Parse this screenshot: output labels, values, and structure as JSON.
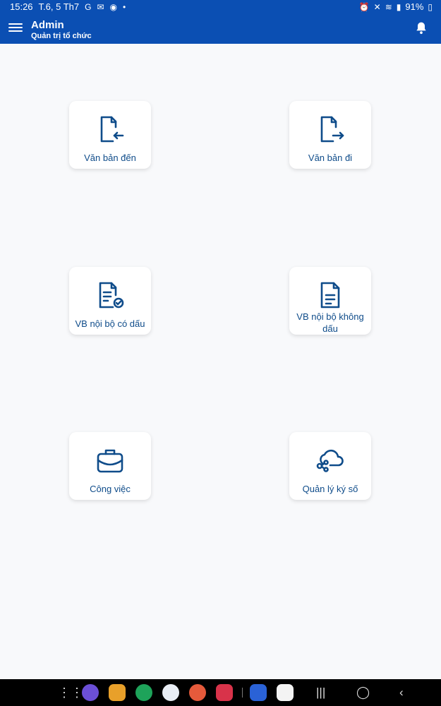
{
  "status_bar": {
    "time": "15:26",
    "date": "T.6, 5 Th7",
    "battery": "91%"
  },
  "app_bar": {
    "title": "Admin",
    "subtitle": "Quản trị tổ chức"
  },
  "tiles": [
    {
      "label": "Văn bản đến",
      "icon": "document-incoming-icon"
    },
    {
      "label": "Văn bản đi",
      "icon": "document-outgoing-icon"
    },
    {
      "label": "VB nội bộ có dấu",
      "icon": "document-check-icon"
    },
    {
      "label": "VB nội bộ không dấu",
      "icon": "document-lines-icon"
    },
    {
      "label": "Công việc",
      "icon": "briefcase-icon"
    },
    {
      "label": "Quản lý ký số",
      "icon": "cloud-share-icon"
    }
  ],
  "nav_bar": {
    "apps": [
      "apps-grid-icon",
      "internet-icon",
      "files-icon",
      "phone-icon",
      "messages-icon",
      "contacts-icon",
      "camera-icon",
      "doc-app-icon",
      "play-store-icon"
    ]
  },
  "colors": {
    "primary": "#0b4fb3",
    "tile_text": "#0f4c8a",
    "background": "#f8f9fb"
  }
}
